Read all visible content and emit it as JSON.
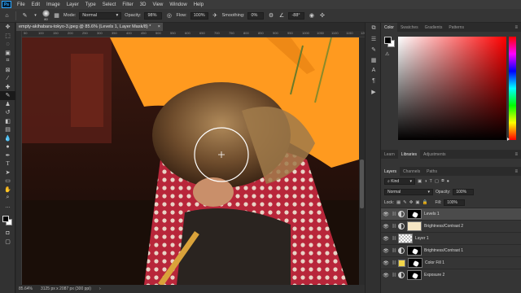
{
  "menu": {
    "logo": "Ps",
    "items": [
      "File",
      "Edit",
      "Image",
      "Layer",
      "Type",
      "Select",
      "Filter",
      "3D",
      "View",
      "Window",
      "Help"
    ]
  },
  "options": {
    "brush_size": "80",
    "mode_label": "Mode:",
    "mode_value": "Normal",
    "opacity_label": "Opacity:",
    "opacity_value": "98%",
    "flow_label": "Flow:",
    "flow_value": "100%",
    "smoothing_label": "Smoothing:",
    "smoothing_value": "0%",
    "angle_value": "-88°"
  },
  "document": {
    "tab_title": "empty-akihabara-tokyo-3.jpeg @ 85.6% (Levels 1, Layer Mask/8) *",
    "close": "×",
    "ruler_ticks": [
      "50",
      "100",
      "150",
      "200",
      "250",
      "300",
      "350",
      "400",
      "450",
      "500",
      "550",
      "600",
      "650",
      "700",
      "750",
      "800",
      "850",
      "900",
      "950",
      "1000",
      "1050",
      "1100",
      "1150",
      "1200"
    ],
    "zoom": "85.64%",
    "doc_info": "3125 px x 2087 px (300 ppi)"
  },
  "color_panel": {
    "tabs": [
      "Color",
      "Swatches",
      "Gradients",
      "Patterns"
    ],
    "fg_color": "#000000",
    "bg_color": "#ffffff"
  },
  "library_panel": {
    "tabs": [
      "Learn",
      "Libraries",
      "Adjustments"
    ]
  },
  "layers_panel": {
    "tabs": [
      "Layers",
      "Channels",
      "Paths"
    ],
    "kind_label": "Kind",
    "blend_mode": "Normal",
    "opacity_label": "Opacity:",
    "opacity_value": "100%",
    "lock_label": "Lock:",
    "fill_label": "Fill:",
    "fill_value": "100%",
    "layers": [
      {
        "name": "Levels 1",
        "selected": true,
        "kind": "adjustment",
        "mask": "white-shape"
      },
      {
        "name": "Brightness/Contrast 2",
        "selected": false,
        "kind": "adjustment",
        "mask": "cream"
      },
      {
        "name": "Layer 1",
        "selected": false,
        "kind": "pixel",
        "mask": "checker"
      },
      {
        "name": "Brightness/Contrast 1",
        "selected": false,
        "kind": "adjustment",
        "mask": "white-shape"
      },
      {
        "name": "Color Fill 1",
        "selected": false,
        "kind": "fill",
        "mask": "white-shape"
      },
      {
        "name": "Exposure 2",
        "selected": false,
        "kind": "adjustment",
        "mask": "white-shape"
      }
    ]
  },
  "colors": {
    "accent": "#31a8ff",
    "umbrella": "#ff9a1f",
    "coat": "#b8263a",
    "fill_swatch": "#f2d64a"
  }
}
